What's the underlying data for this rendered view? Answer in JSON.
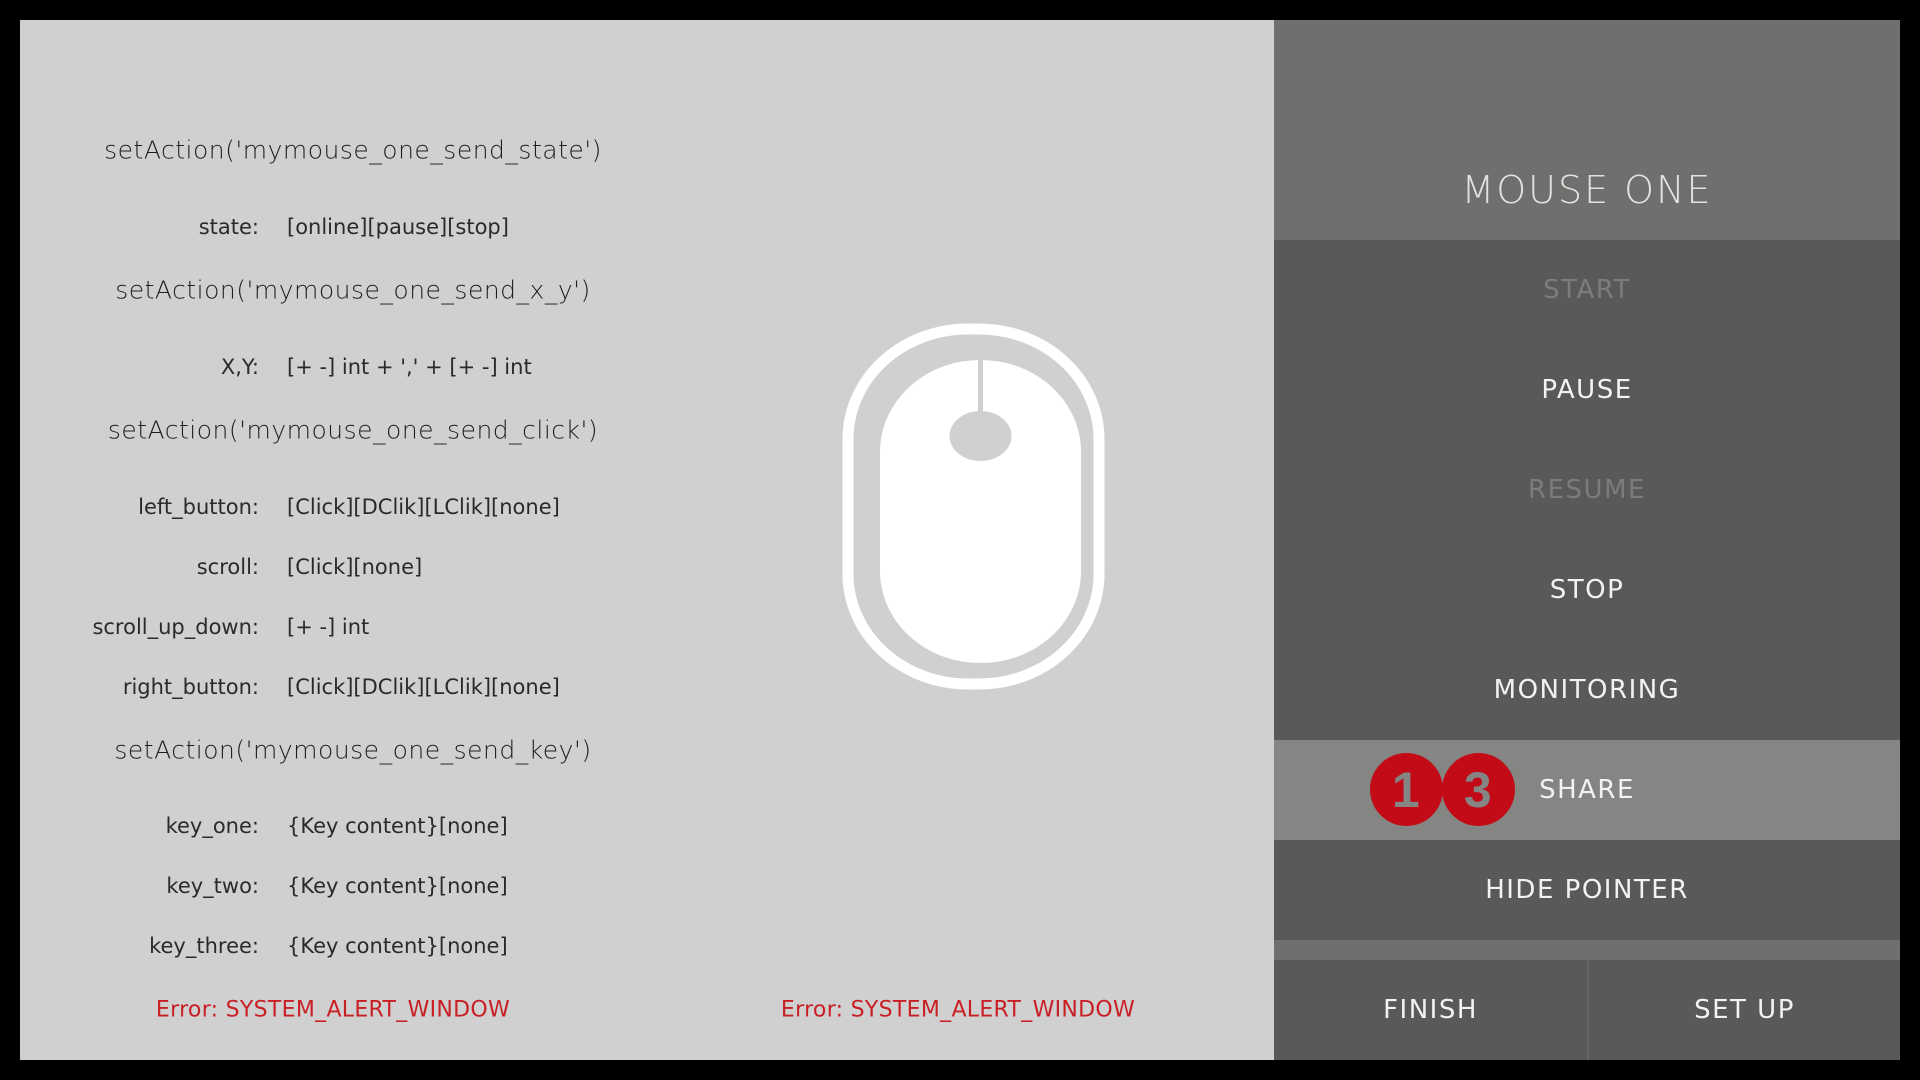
{
  "doc": {
    "sections": [
      {
        "title": "setAction('mymouse_one_send_state')",
        "params": [
          {
            "key": "state:",
            "value": "[online][pause][stop]"
          }
        ]
      },
      {
        "title": "setAction('mymouse_one_send_x_y')",
        "params": [
          {
            "key": "X,Y:",
            "value": "[+ -] int + ',' + [+ -] int"
          }
        ]
      },
      {
        "title": "setAction('mymouse_one_send_click')",
        "params": [
          {
            "key": "left_button:",
            "value": "[Click][DClik][LClik][none]"
          },
          {
            "key": "scroll:",
            "value": "[Click][none]"
          },
          {
            "key": "scroll_up_down:",
            "value": "[+ -] int"
          },
          {
            "key": "right_button:",
            "value": "[Click][DClik][LClik][none]"
          }
        ]
      },
      {
        "title": "setAction('mymouse_one_send_key')",
        "params": [
          {
            "key": "key_one:",
            "value": "{Key content}[none]"
          },
          {
            "key": "key_two:",
            "value": "{Key content}[none]"
          },
          {
            "key": "key_three:",
            "value": "{Key content}[none]"
          }
        ]
      }
    ],
    "error_left": "Error: SYSTEM_ALERT_WINDOW"
  },
  "preview": {
    "icon": "mouse-icon",
    "error": "Error: SYSTEM_ALERT_WINDOW"
  },
  "panel": {
    "title": "MOUSE ONE",
    "menu": [
      {
        "label": "START",
        "state": "disabled"
      },
      {
        "label": "PAUSE",
        "state": "enabled"
      },
      {
        "label": "RESUME",
        "state": "disabled"
      },
      {
        "label": "STOP",
        "state": "enabled"
      },
      {
        "label": "MONITORING",
        "state": "enabled"
      },
      {
        "label": "SHARE",
        "state": "active"
      },
      {
        "label": "HIDE POINTER",
        "state": "enabled"
      }
    ],
    "badges": [
      "1",
      "3"
    ],
    "finish_label": "FINISH",
    "setup_label": "SET UP"
  },
  "colors": {
    "content_bg": "#d0d0d0",
    "panel_bg": "#595959",
    "header_bg": "#6f6f6d",
    "active_row_bg": "#858584",
    "error_text": "#c81f25",
    "badge_bg": "#c20b17"
  }
}
